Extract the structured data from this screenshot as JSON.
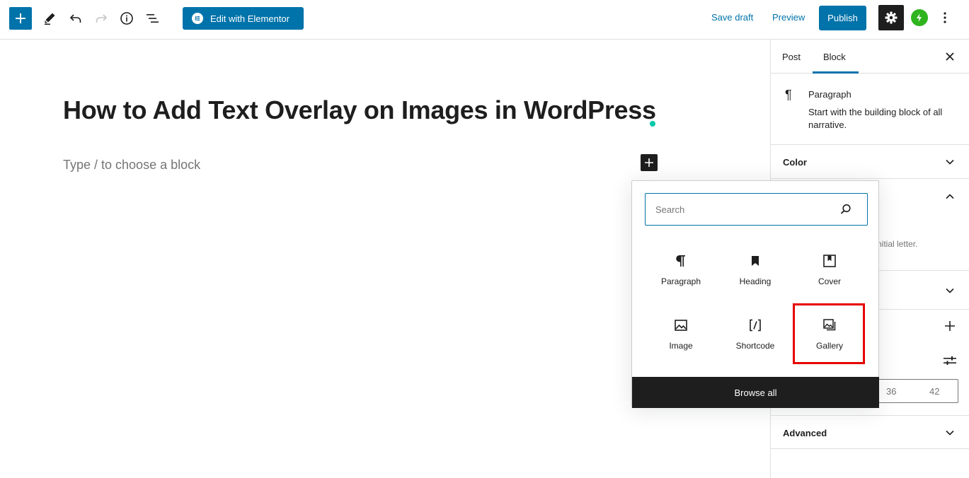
{
  "toolbar": {
    "elementor_label": "Edit with Elementor",
    "save_draft": "Save draft",
    "preview": "Preview",
    "publish": "Publish"
  },
  "editor": {
    "title": "How to Add Text Overlay on Images in WordPress",
    "placeholder": "Type / to choose a block"
  },
  "sidebar": {
    "tabs": [
      "Post",
      "Block"
    ],
    "active_tab": "Block",
    "block": {
      "name": "Paragraph",
      "description": "Start with the building block of all narrative."
    },
    "panels": {
      "color": "Color",
      "advanced": "Advanced"
    },
    "drop_cap_help_partial": "nitial letter.",
    "font_sizes": [
      "36",
      "42"
    ]
  },
  "inserter": {
    "search_placeholder": "Search",
    "items": [
      {
        "label": "Paragraph",
        "icon": "paragraph-icon"
      },
      {
        "label": "Heading",
        "icon": "bookmark-icon"
      },
      {
        "label": "Cover",
        "icon": "cover-icon"
      },
      {
        "label": "Image",
        "icon": "image-icon"
      },
      {
        "label": "Shortcode",
        "icon": "shortcode-icon"
      },
      {
        "label": "Gallery",
        "icon": "gallery-icon"
      }
    ],
    "highlighted": "Gallery",
    "browse_all": "Browse all"
  },
  "colors": {
    "accent": "#0073aa",
    "dark": "#1e1e1e",
    "highlight": "#e60000",
    "jetpack": "#2fb41f",
    "dot": "#00c9a7"
  }
}
